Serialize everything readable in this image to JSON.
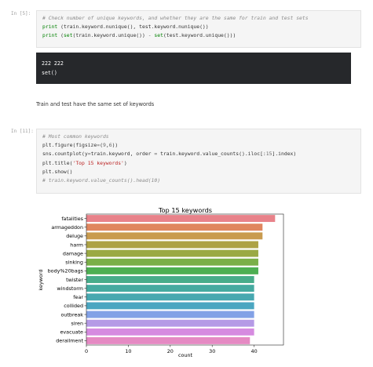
{
  "cells": {
    "cell1": {
      "prompt": "In [5]:",
      "line1": "# Check number of unique keywords, and whether they are the same for train and test sets",
      "line2_fn": "print",
      "line2_rest": " (train.keyword.nunique(), test.keyword.nunique())",
      "line3_fn": "print",
      "line3_a": " (",
      "line3_set1": "set",
      "line3_b": "(train.keyword.unique()) ",
      "line3_minus": "-",
      "line3_c": " ",
      "line3_set2": "set",
      "line3_d": "(test.keyword.unique()))"
    },
    "output1": {
      "line1": "222 222",
      "line2": "set()"
    },
    "markdown1": {
      "text": "Train and test have the same set of keywords"
    },
    "cell2": {
      "prompt": "In [11]:",
      "line1": "# Most common keywords",
      "line2_a": "plt.figure(figsize",
      "line2_eq": "=",
      "line2_b": "(",
      "line2_n1": "9",
      "line2_c": ",",
      "line2_n2": "6",
      "line2_d": "))",
      "line3_a": "sns.countplot(y",
      "line3_eq1": "=",
      "line3_b": "train.keyword, order ",
      "line3_eq2": "=",
      "line3_c": " train.keyword.value_counts().iloc[:",
      "line3_n": "15",
      "line3_d": "].index)",
      "line4_a": "plt.title(",
      "line4_str": "'Top 15 keywords'",
      "line4_b": ")",
      "line5": "plt.show()",
      "line6": "# train.keyword.value_counts().head(10)"
    }
  },
  "chart_data": {
    "type": "bar",
    "orientation": "horizontal",
    "title": "Top 15 keywords",
    "xlabel": "count",
    "ylabel": "keyword",
    "categories": [
      "fatalities",
      "armageddon",
      "deluge",
      "harm",
      "damage",
      "sinking",
      "body%20bags",
      "twister",
      "windstorm",
      "fear",
      "collided",
      "outbreak",
      "siren",
      "evacuate",
      "derailment"
    ],
    "values": [
      45,
      42,
      42,
      41,
      41,
      41,
      41,
      40,
      40,
      40,
      40,
      40,
      40,
      40,
      39
    ],
    "xlim": [
      0,
      47
    ],
    "xticks": [
      0,
      10,
      20,
      30,
      40
    ],
    "grid": false,
    "colors": [
      "#e8828a",
      "#e0865e",
      "#c99b4f",
      "#ada245",
      "#9aa944",
      "#7aaf48",
      "#4daf52",
      "#47ac8a",
      "#45aaa0",
      "#47a8b0",
      "#4aa6c1",
      "#82a1e6",
      "#b59ae6",
      "#d68be0",
      "#e58ac3"
    ]
  }
}
